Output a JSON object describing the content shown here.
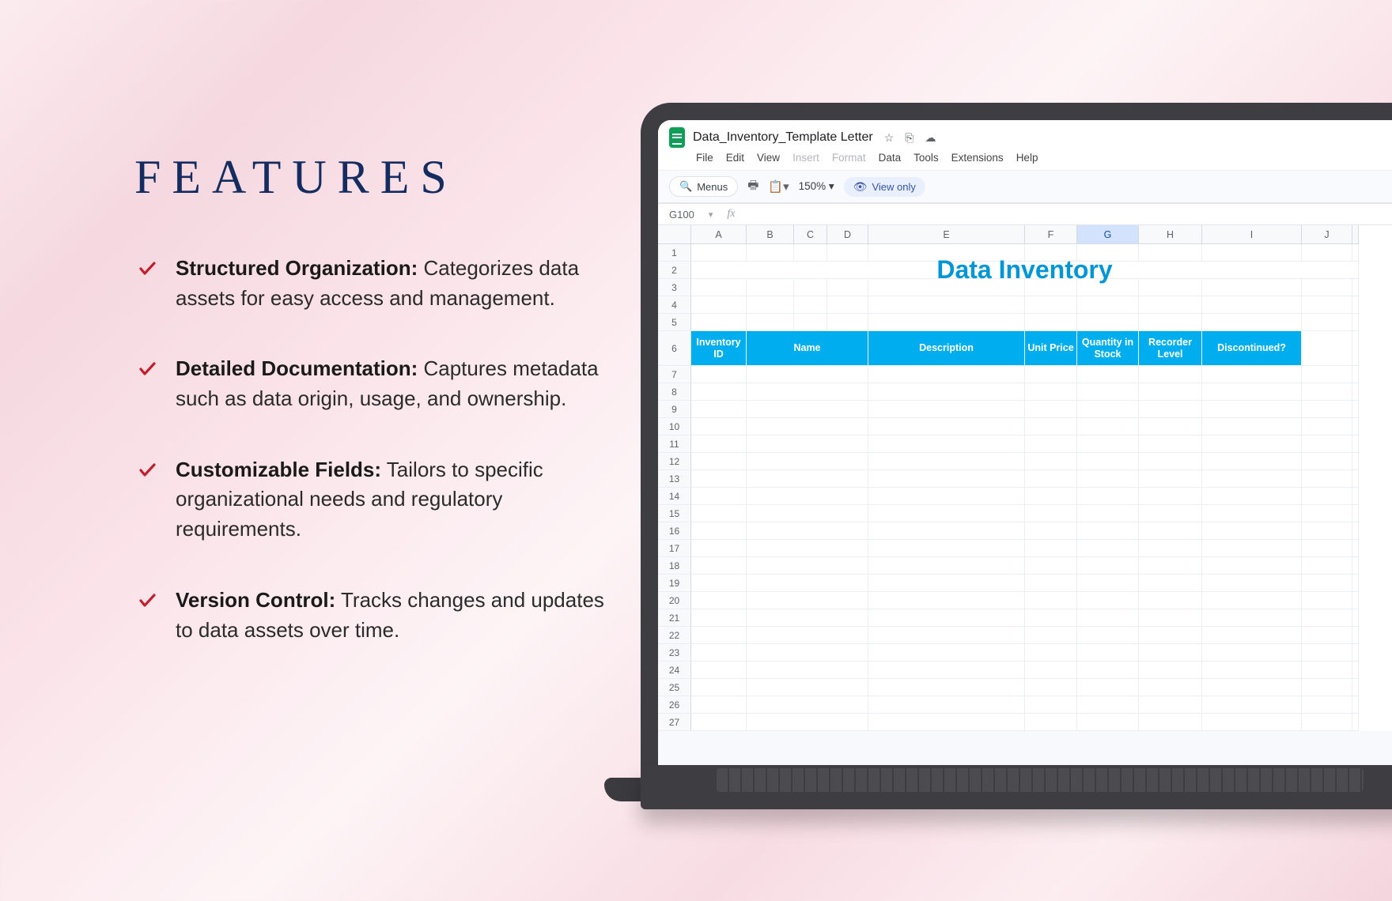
{
  "left": {
    "title": "FEATURES",
    "features": [
      {
        "bold": "Structured Organization:",
        "text": " Categorizes data assets for easy access and management."
      },
      {
        "bold": "Detailed Documentation:",
        "text": " Captures metadata such as data origin, usage, and ownership."
      },
      {
        "bold": "Customizable Fields:",
        "text": " Tailors to specific organizational needs and regulatory requirements."
      },
      {
        "bold": "Version Control:",
        "text": " Tracks changes and updates to data assets over time."
      }
    ]
  },
  "sheets": {
    "doc_title": "Data_Inventory_Template Letter",
    "title_icons": {
      "star": "☆",
      "folder": "⎘",
      "cloud": "☁"
    },
    "menu": [
      "File",
      "Edit",
      "View",
      "Insert",
      "Format",
      "Data",
      "Tools",
      "Extensions",
      "Help"
    ],
    "menu_dim": {
      "Insert": true,
      "Format": true
    },
    "toolbar": {
      "menus_label": "Menus",
      "zoom": "150%",
      "view_only": "View only"
    },
    "cell_ref": "G100",
    "columns": [
      "A",
      "B",
      "C",
      "D",
      "E",
      "F",
      "G",
      "H",
      "I",
      "J",
      ""
    ],
    "selected_col": "G",
    "sheet_title": "Data Inventory",
    "row_count": 27,
    "table_headers": [
      {
        "col": "A",
        "label": "Inventory ID"
      },
      {
        "col": "B",
        "label": "Name"
      },
      {
        "col": "E",
        "label": "Description"
      },
      {
        "col": "F",
        "label": "Unit Price"
      },
      {
        "col": "G",
        "label": "Quantity in Stock"
      },
      {
        "col": "H",
        "label": "Recorder Level"
      },
      {
        "col": "I",
        "label": "Discontinued?"
      }
    ],
    "merged": {
      "name_span": [
        "B",
        "C",
        "D"
      ],
      "description_span": [
        "E"
      ]
    }
  }
}
